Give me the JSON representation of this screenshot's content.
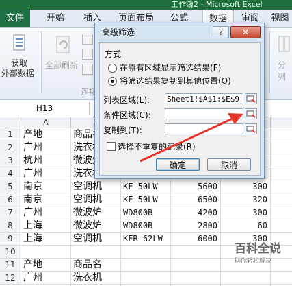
{
  "window": {
    "title": "工作簿2 - Microsoft Excel"
  },
  "ribbon": {
    "tabs": [
      {
        "label": "文件"
      },
      {
        "label": "开始"
      },
      {
        "label": "插入"
      },
      {
        "label": "页面布局"
      },
      {
        "label": "公式"
      },
      {
        "label": "数据"
      },
      {
        "label": "审阅"
      },
      {
        "label": "视图"
      }
    ],
    "get_external_line1": "获取",
    "get_external_line2": "外部数据",
    "refresh_all": "全部刷新",
    "connections": "连接",
    "split": "分列"
  },
  "formula_bar": {
    "name_box": "H13"
  },
  "columns": [
    "A",
    "B",
    "C",
    "D",
    "E"
  ],
  "rows": [
    {
      "n": "1",
      "a": "产地",
      "b": "商品名",
      "c": "",
      "d": "",
      "e": ""
    },
    {
      "n": "2",
      "a": "广州",
      "b": "洗衣机",
      "c": "",
      "d": "",
      "e": ""
    },
    {
      "n": "3",
      "a": "杭州",
      "b": "微波炉",
      "c": "",
      "d": "",
      "e": ""
    },
    {
      "n": "4",
      "a": "广州",
      "b": "洗衣机",
      "c": "",
      "d": "",
      "e": ""
    },
    {
      "n": "5",
      "a": "南京",
      "b": "空调机",
      "c": "KF-50LW",
      "d": "5600",
      "e": "300"
    },
    {
      "n": "6",
      "a": "南京",
      "b": "空调机",
      "c": "KF-50LW",
      "d": "6500",
      "e": "320"
    },
    {
      "n": "7",
      "a": "广州",
      "b": "微波炉",
      "c": "WD800B",
      "d": "4200",
      "e": "300"
    },
    {
      "n": "8",
      "a": "上海",
      "b": "微波炉",
      "c": "WD800B",
      "d": "2800",
      "e": "60"
    },
    {
      "n": "9",
      "a": "上海",
      "b": "空调机",
      "c": "KFR-62LW",
      "d": "6000",
      "e": "300"
    },
    {
      "n": "10",
      "a": "",
      "b": "",
      "c": "",
      "d": "",
      "e": ""
    },
    {
      "n": "11",
      "a": "产地",
      "b": "商品名",
      "c": "",
      "d": "",
      "e": ""
    },
    {
      "n": "12",
      "a": "广州",
      "b": "洗衣机",
      "c": "",
      "d": "",
      "e": ""
    }
  ],
  "dialog": {
    "title": "高级筛选",
    "help": "?",
    "close": "✕",
    "method_label": "方式",
    "option1": "在原有区域显示筛选结果(F)",
    "option2": "将筛选结果复制到其他位置(O)",
    "list_range_label": "列表区域(L):",
    "list_range_value": "Sheet1!$A$1:$E$9",
    "criteria_range_label": "条件区域(C):",
    "criteria_range_value": "",
    "copy_to_label": "复制到(T):",
    "copy_to_value": "",
    "unique_label": "选择不重复的记录(R)",
    "ok": "确定",
    "cancel": "取消"
  },
  "watermark": {
    "title": "百科全说",
    "subtitle": "助你轻松解决"
  },
  "colors": {
    "accent": "#1e7145",
    "arrow": "#e8332a"
  }
}
